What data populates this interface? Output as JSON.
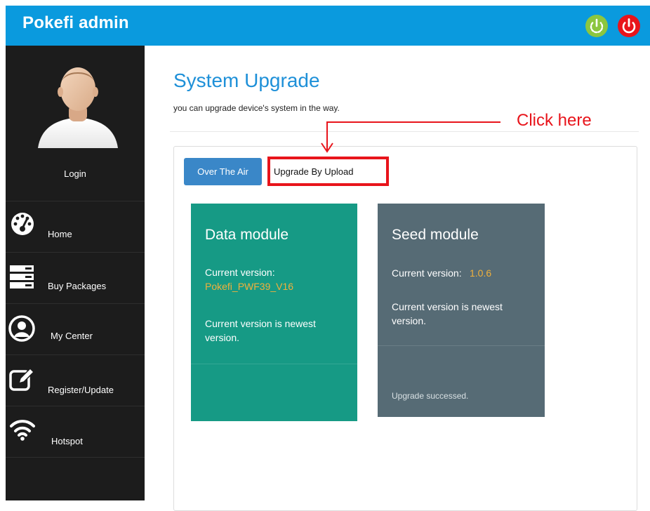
{
  "header": {
    "title": "Pokefi admin",
    "restart_icon": "restart-power-icon",
    "power_icon": "power-off-icon",
    "colors": {
      "bar": "#0a9ade",
      "restart": "#8cc63f",
      "power": "#e8141b"
    }
  },
  "sidebar": {
    "login_label": "Login",
    "items": [
      {
        "label": "Home",
        "icon": "dashboard-gauge-icon"
      },
      {
        "label": "Buy Packages",
        "icon": "server-stack-icon"
      },
      {
        "label": "My Center",
        "icon": "user-circle-icon"
      },
      {
        "label": "Register/Update",
        "icon": "edit-pencil-icon"
      },
      {
        "label": "Hotspot",
        "icon": "wifi-icon"
      }
    ]
  },
  "page": {
    "title": "System Upgrade",
    "subtitle": "you can upgrade device's system in the way."
  },
  "tabs": {
    "over_the_air": "Over The Air",
    "upgrade_by_upload": "Upgrade By Upload"
  },
  "cards": {
    "data_module": {
      "title": "Data module",
      "version_label": "Current version:",
      "version_value": "Pokefi_PWF39_V16",
      "status": "Current version is newest version.",
      "color": "#169a85"
    },
    "seed_module": {
      "title": "Seed module",
      "version_label": "Current version:",
      "version_value": "1.0.6",
      "status": "Current version is newest version.",
      "footer": "Upgrade successed.",
      "color": "#566b75"
    }
  },
  "annotation": {
    "text": "Click here",
    "color": "#e8141b"
  }
}
